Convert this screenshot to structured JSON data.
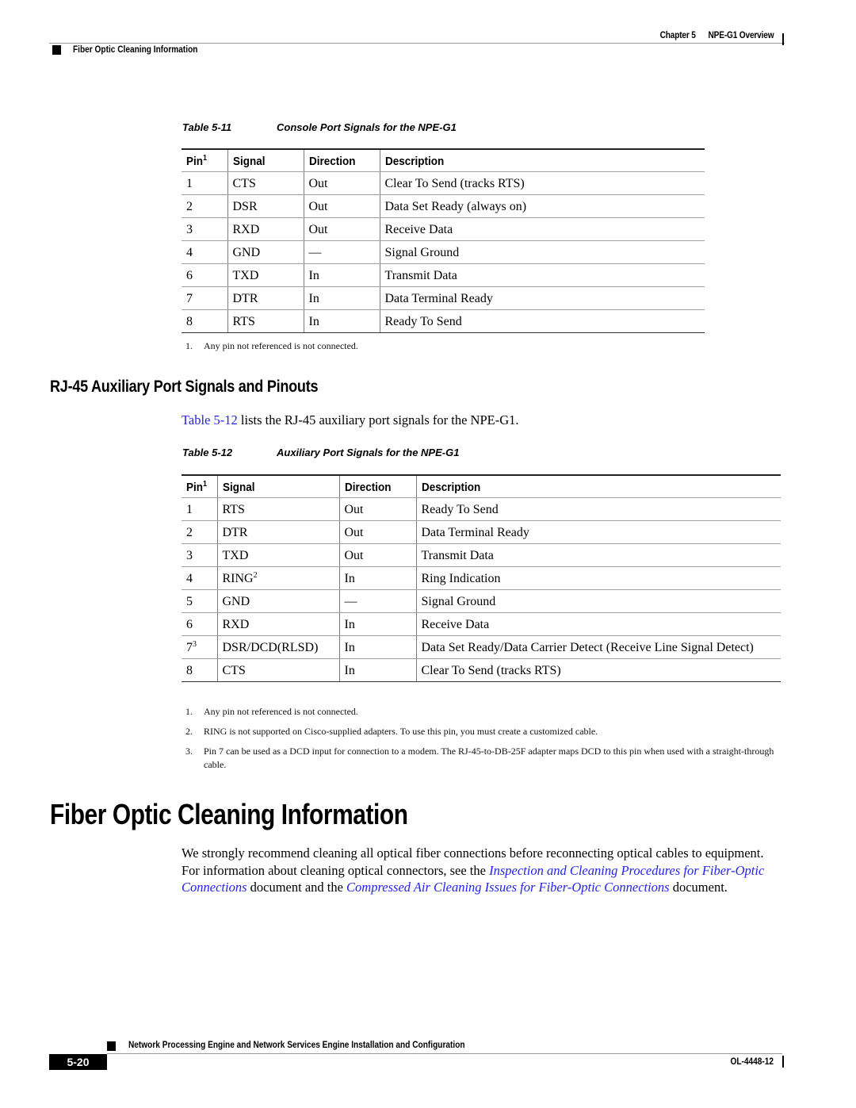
{
  "header": {
    "chapter": "Chapter 5",
    "chapter_title": "NPE-G1 Overview",
    "section": "Fiber Optic Cleaning Information"
  },
  "table1": {
    "number": "Table 5-11",
    "title": "Console Port Signals for the NPE-G1",
    "columns": [
      "Pin",
      "Signal",
      "Direction",
      "Description"
    ],
    "pin_footnote_marker": "1",
    "rows": [
      {
        "pin": "1",
        "signal": "CTS",
        "direction": "Out",
        "description": "Clear To Send (tracks RTS)"
      },
      {
        "pin": "2",
        "signal": "DSR",
        "direction": "Out",
        "description": "Data Set Ready (always on)"
      },
      {
        "pin": "3",
        "signal": "RXD",
        "direction": "Out",
        "description": "Receive Data"
      },
      {
        "pin": "4",
        "signal": "GND",
        "direction": "—",
        "description": "Signal Ground"
      },
      {
        "pin": "6",
        "signal": "TXD",
        "direction": "In",
        "description": "Transmit Data"
      },
      {
        "pin": "7",
        "signal": "DTR",
        "direction": "In",
        "description": "Data Terminal Ready"
      },
      {
        "pin": "8",
        "signal": "RTS",
        "direction": "In",
        "description": "Ready To Send"
      }
    ],
    "footnotes": [
      {
        "n": "1.",
        "text": "Any pin not referenced is not connected."
      }
    ]
  },
  "section_rj45": {
    "heading": "RJ-45 Auxiliary Port Signals and Pinouts",
    "intro_link": "Table 5-12",
    "intro_rest": " lists the RJ-45 auxiliary port signals for the NPE-G1."
  },
  "table2": {
    "number": "Table 5-12",
    "title": "Auxiliary Port Signals for the NPE-G1",
    "columns": [
      "Pin",
      "Signal",
      "Direction",
      "Description"
    ],
    "pin_footnote_marker": "1",
    "rows": [
      {
        "pin": "1",
        "pin_sup": "",
        "signal": "RTS",
        "signal_sup": "",
        "direction": "Out",
        "description": "Ready To Send"
      },
      {
        "pin": "2",
        "pin_sup": "",
        "signal": "DTR",
        "signal_sup": "",
        "direction": "Out",
        "description": "Data Terminal Ready"
      },
      {
        "pin": "3",
        "pin_sup": "",
        "signal": "TXD",
        "signal_sup": "",
        "direction": "Out",
        "description": "Transmit Data"
      },
      {
        "pin": "4",
        "pin_sup": "",
        "signal": "RING",
        "signal_sup": "2",
        "direction": "In",
        "description": "Ring Indication"
      },
      {
        "pin": "5",
        "pin_sup": "",
        "signal": "GND",
        "signal_sup": "",
        "direction": "—",
        "description": "Signal Ground"
      },
      {
        "pin": "6",
        "pin_sup": "",
        "signal": "RXD",
        "signal_sup": "",
        "direction": "In",
        "description": "Receive Data"
      },
      {
        "pin": "7",
        "pin_sup": "3",
        "signal": "DSR/DCD(RLSD)",
        "signal_sup": "",
        "direction": "In",
        "description": "Data Set Ready/Data Carrier Detect (Receive Line Signal Detect)"
      },
      {
        "pin": "8",
        "pin_sup": "",
        "signal": "CTS",
        "signal_sup": "",
        "direction": "In",
        "description": "Clear To Send (tracks RTS)"
      }
    ],
    "footnotes": [
      {
        "n": "1.",
        "text": "Any pin not referenced is not connected."
      },
      {
        "n": "2.",
        "text": "RING is not supported on Cisco-supplied adapters. To use this pin, you must create a customized cable."
      },
      {
        "n": "3.",
        "text": "Pin 7 can be used as a DCD input for connection to a modem. The RJ-45-to-DB-25F adapter maps DCD to this pin when used with a straight-through cable."
      }
    ]
  },
  "section_fiber": {
    "heading": "Fiber Optic Cleaning Information",
    "p1": "We strongly recommend cleaning all optical fiber connections before reconnecting optical cables to equipment. For information about cleaning optical connectors, see the ",
    "link1": "Inspection and Cleaning Procedures for Fiber-Optic Connections",
    "p2": " document and the ",
    "link2": "Compressed Air Cleaning Issues for Fiber-Optic Connections",
    "p3": " document."
  },
  "footer": {
    "title": "Network Processing Engine and Network Services Engine Installation and Configuration",
    "page": "5-20",
    "doc_number": "OL-4448-12"
  }
}
